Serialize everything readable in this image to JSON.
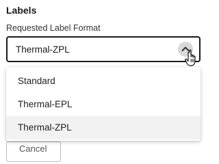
{
  "section": {
    "title": "Labels"
  },
  "field": {
    "label": "Requested Label Format",
    "selected_value": "Thermal-ZPL"
  },
  "dropdown": {
    "options": [
      {
        "label": "Standard"
      },
      {
        "label": "Thermal-EPL"
      },
      {
        "label": "Thermal-ZPL"
      }
    ],
    "selected_index": 2
  },
  "footer": {
    "button_label": "Cancel"
  },
  "icons": {
    "chevron": "chevron-up-icon",
    "cursor": "hand-pointer-icon"
  },
  "colors": {
    "border": "#1a1a1a",
    "chevron_bg": "#d9d9d9",
    "selected_option_bg": "#f2f2f2"
  }
}
